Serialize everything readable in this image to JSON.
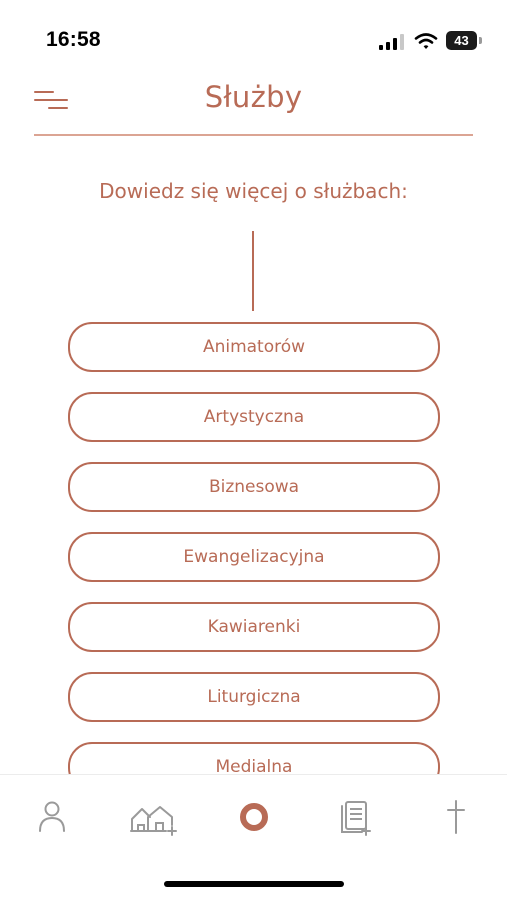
{
  "status_bar": {
    "time": "16:58",
    "battery": "43",
    "icons": [
      "signal-icon",
      "wifi-icon",
      "battery-icon"
    ]
  },
  "header": {
    "title": "Służby",
    "menu_icon": "menu-icon"
  },
  "main": {
    "subtitle": "Dowiedz się więcej o służbach:",
    "services": [
      "Animatorów",
      "Artystyczna",
      "Biznesowa",
      "Ewangelizacyjna",
      "Kawiarenki",
      "Liturgiczna",
      "Medialna"
    ]
  },
  "bottom_nav": {
    "items": [
      "person-icon",
      "houses-icon",
      "ring-icon",
      "document-icon",
      "cross-icon"
    ],
    "active": "ring-icon"
  },
  "colors": {
    "accent": "#b86b56",
    "divider": "#dba493",
    "inactive_icon": "#9a9a9a"
  }
}
